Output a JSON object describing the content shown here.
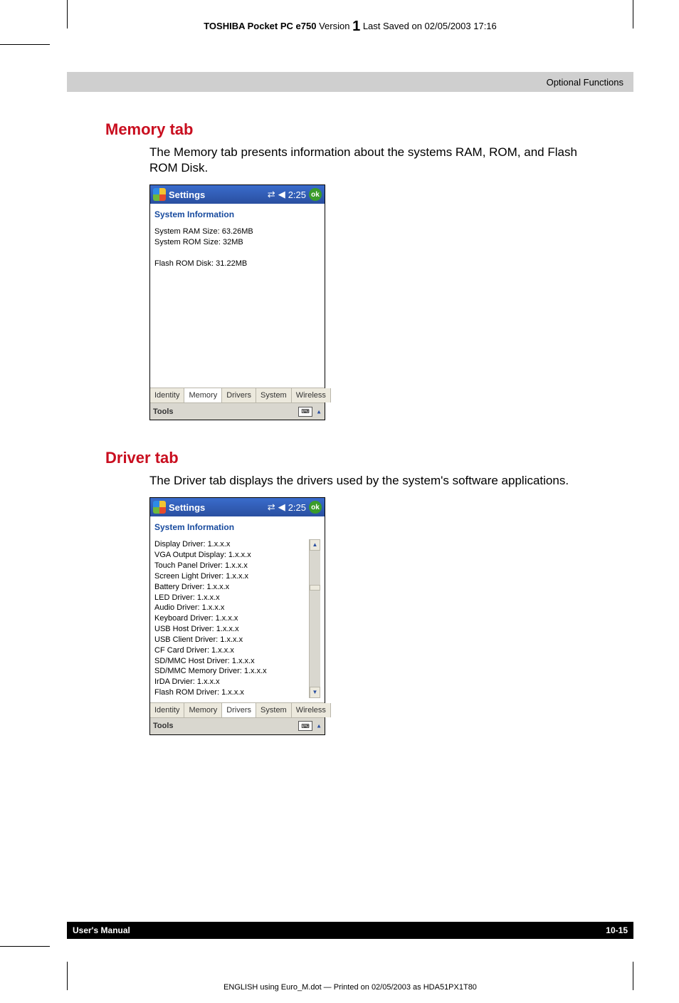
{
  "header": {
    "product_bold": "TOSHIBA Pocket PC e750",
    "version_word": "Version",
    "version_num": "1",
    "saved": "Last Saved on 02/05/2003 17:16"
  },
  "grayband": {
    "text": "Optional Functions"
  },
  "section1": {
    "heading": "Memory tab",
    "desc": "The Memory tab presents information about the systems RAM, ROM, and Flash ROM Disk."
  },
  "section2": {
    "heading": "Driver tab",
    "desc": "The Driver tab displays the drivers used by the system's software applications."
  },
  "shot_common": {
    "title": "Settings",
    "time": "2:25",
    "ok": "ok",
    "subhead": "System Information",
    "tabs": [
      "Identity",
      "Memory",
      "Drivers",
      "System",
      "Wireless"
    ],
    "tools": "Tools"
  },
  "memory": {
    "lines": [
      "System RAM Size: 63.26MB",
      "System ROM Size: 32MB",
      "",
      "Flash ROM Disk: 31.22MB"
    ],
    "active_tab_index": 1
  },
  "drivers": {
    "lines": [
      "Display Driver: 1.x.x.x",
      "VGA Output Display: 1.x.x.x",
      "Touch Panel Driver: 1.x.x.x",
      "Screen Light Driver: 1.x.x.x",
      "Battery Driver: 1.x.x.x",
      "LED Driver: 1.x.x.x",
      "Audio Driver: 1.x.x.x",
      "Keyboard Driver: 1.x.x.x",
      "USB Host Driver: 1.x.x.x",
      "USB Client Driver: 1.x.x.x",
      "CF Card Driver: 1.x.x.x",
      "SD/MMC Host Driver: 1.x.x.x",
      "SD/MMC Memory Driver: 1.x.x.x",
      "IrDA Drvier: 1.x.x.x",
      "Flash ROM Driver: 1.x.x.x"
    ],
    "active_tab_index": 2
  },
  "footer": {
    "manual": "User's Manual",
    "page": "10-15",
    "note": "ENGLISH using Euro_M.dot — Printed on 02/05/2003 as HDA51PX1T80"
  }
}
